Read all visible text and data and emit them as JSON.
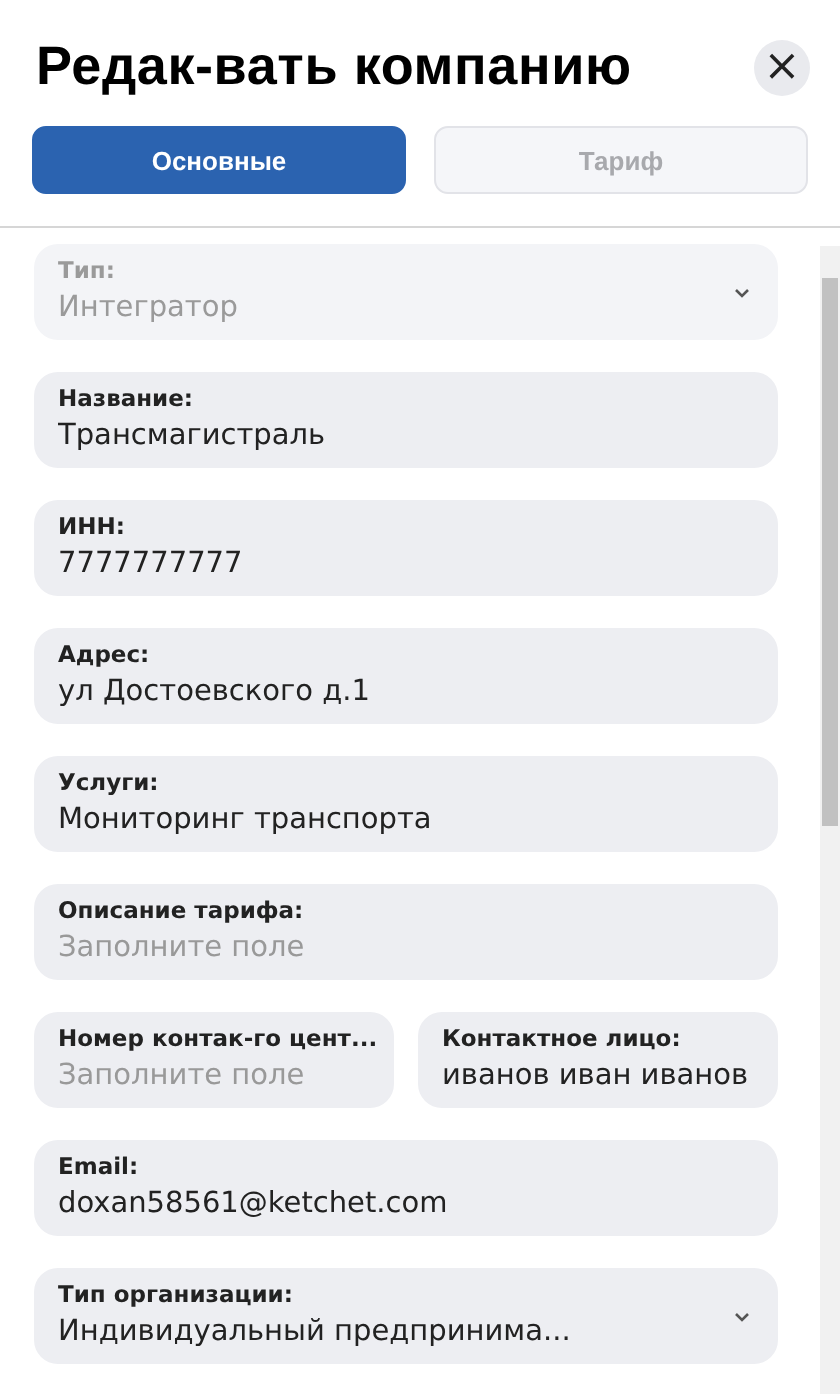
{
  "window": {
    "title": "Редак-вать компанию"
  },
  "close": {
    "icon": "×"
  },
  "tabs": [
    {
      "label": "Основные",
      "selected": true
    },
    {
      "label": "Тариф",
      "selected": false
    }
  ],
  "rows": [
    {
      "fields": [
        {
          "kind": "select",
          "label": "Тип:",
          "value": "Интегратор",
          "disabled": true
        }
      ]
    },
    {
      "fields": [
        {
          "kind": "text",
          "label": "Название:",
          "value": "Трансмагистраль",
          "disabled": false
        }
      ]
    },
    {
      "fields": [
        {
          "kind": "text",
          "label": "ИНН:",
          "value": "7777777777",
          "disabled": false
        }
      ]
    },
    {
      "fields": [
        {
          "kind": "text",
          "label": "Адрес:",
          "value": "ул Достоевского д.1",
          "disabled": false
        }
      ]
    },
    {
      "fields": [
        {
          "kind": "text",
          "label": "Услуги:",
          "value": "Мониторинг транспорта",
          "disabled": false
        }
      ]
    },
    {
      "fields": [
        {
          "kind": "text",
          "label": "Описание тарифа:",
          "placeholder": "Заполните поле",
          "disabled": false
        }
      ]
    },
    {
      "fields": [
        {
          "kind": "text",
          "label": "Номер контак-го цент...",
          "placeholder": "Заполните поле",
          "disabled": false
        },
        {
          "kind": "text",
          "label": "Контактное лицо:",
          "value": "иванов иван иванов",
          "disabled": false
        }
      ]
    },
    {
      "fields": [
        {
          "kind": "text",
          "label": "Email:",
          "value": "doxan58561@ketchet.com",
          "disabled": false
        }
      ]
    },
    {
      "fields": [
        {
          "kind": "select",
          "label": "Тип организации:",
          "value": "Индивидуальный предпринима...",
          "disabled": false
        }
      ]
    }
  ]
}
